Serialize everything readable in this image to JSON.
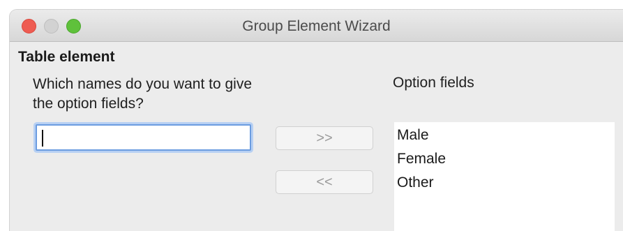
{
  "window": {
    "title": "Group Element Wizard"
  },
  "section": {
    "title": "Table element"
  },
  "prompt": {
    "text": "Which names do you want to give the option fields?"
  },
  "name_input": {
    "value": ""
  },
  "buttons": {
    "add_label": ">>",
    "remove_label": "<<"
  },
  "options": {
    "label": "Option fields",
    "items": [
      "Male",
      "Female",
      "Other"
    ]
  }
}
